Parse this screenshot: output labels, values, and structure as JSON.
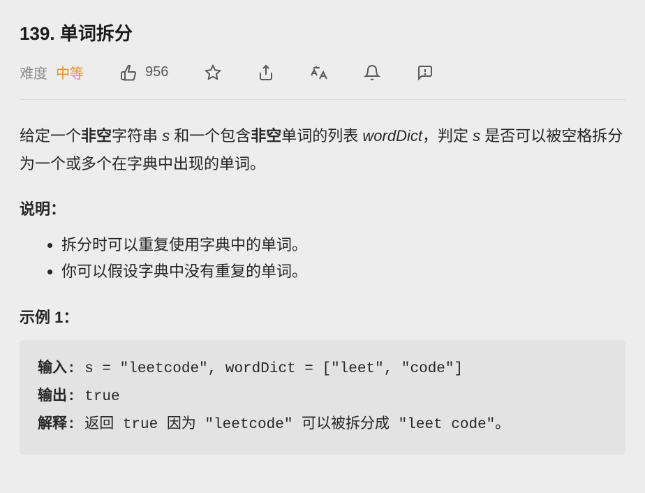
{
  "problem": {
    "number": "139.",
    "title": "单词拆分",
    "difficulty_label": "难度",
    "difficulty_value": "中等",
    "likes": "956"
  },
  "description": {
    "prefix1": "给定一个",
    "bold1": "非空",
    "mid1": "字符串 ",
    "italic1": "s",
    "mid2": " 和一个包含",
    "bold2": "非空",
    "mid3": "单词的列表 ",
    "italic2": "wordDict",
    "suffix": "，判定 ",
    "italic3": "s",
    "tail": " 是否可以被空格拆分为一个或多个在字典中出现的单词。"
  },
  "notes": {
    "heading": "说明：",
    "items": [
      "拆分时可以重复使用字典中的单词。",
      "你可以假设字典中没有重复的单词。"
    ]
  },
  "example": {
    "heading": "示例 1：",
    "input_label": "输入: ",
    "input_value": "s = \"leetcode\", wordDict = [\"leet\", \"code\"]",
    "output_label": "输出: ",
    "output_value": "true",
    "explain_label": "解释: ",
    "explain_value": "返回 true 因为 \"leetcode\" 可以被拆分成 \"leet code\"。"
  }
}
